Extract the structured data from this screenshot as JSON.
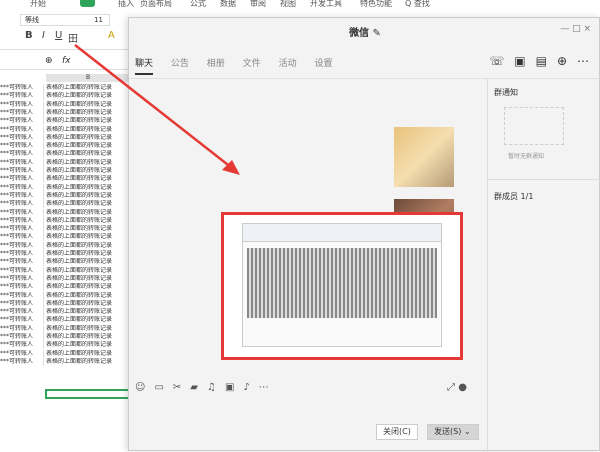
{
  "sheet": {
    "menu": [
      "开始",
      "插入",
      "页面布局",
      "公式",
      "数据",
      "审阅",
      "视图",
      "开发工具",
      "特色功能",
      "Q 查找"
    ],
    "font_name": "等线",
    "font_size": "11",
    "format_buttons": [
      "B",
      "I",
      "U",
      "田",
      "A"
    ],
    "fx": "fx",
    "col_header": "B",
    "col_a_text": "***可转账人",
    "col_b_text": "表格的上面都的转账记录"
  },
  "chat": {
    "title": "微信",
    "window_controls": [
      "—",
      "□",
      "×"
    ],
    "tabs": [
      "聊天",
      "公告",
      "相册",
      "文件",
      "活动",
      "设置"
    ],
    "active_tab": "聊天",
    "side": {
      "notice_label": "群通知",
      "notice_hint": "暂时无群通知",
      "members_label": "群成员 1/1"
    },
    "buttons": {
      "close": "关闭(C)",
      "send": "发送(S)"
    }
  },
  "colors": {
    "annotation": "#e53935",
    "accent": "#2fa55a"
  }
}
